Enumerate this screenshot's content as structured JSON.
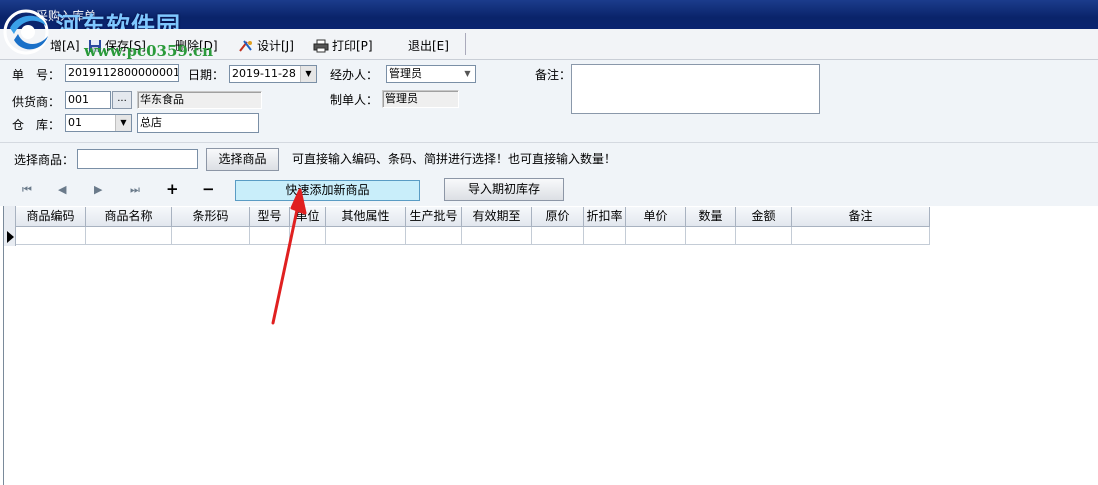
{
  "window": {
    "title": "采购入库单"
  },
  "watermark": {
    "site_name": "河东软件园",
    "url": "www.pc0359.cn"
  },
  "toolbar": {
    "add_label": "增[A]",
    "save_label": "保存[S]",
    "delete_label": "删除[D]",
    "design_label": "设计[J]",
    "print_label": "打印[P]",
    "exit_label": "退出[E]"
  },
  "form": {
    "order_no_label": "单　号：",
    "order_no_value": "2019112800000001",
    "date_label": "日期：",
    "date_value": "2019-11-28",
    "handler_label": "经办人：",
    "handler_value": "管理员",
    "remark_label": "备注：",
    "supplier_label": "供货商：",
    "supplier_code": "001",
    "supplier_browse": "...",
    "supplier_name": "华东食品",
    "creator_label": "制单人：",
    "creator_value": "管理员",
    "warehouse_label": "仓　库：",
    "warehouse_code": "01",
    "warehouse_name": "总店"
  },
  "select": {
    "label": "选择商品：",
    "input_value": "",
    "button_label": "选择商品",
    "hint": "可直接输入编码、条码、简拼进行选择！也可直接输入数量！",
    "quick_add_label": "快速添加新商品",
    "import_label": "导入期初库存"
  },
  "navigator": {
    "first": "⏮",
    "prev": "◀",
    "next": "▶",
    "last": "⏭",
    "add": "+",
    "remove": "−"
  },
  "grid": {
    "columns": [
      "商品编码",
      "商品名称",
      "条形码",
      "型号",
      "单位",
      "其他属性",
      "生产批号",
      "有效期至",
      "原价",
      "折扣率",
      "单价",
      "数量",
      "金额",
      "备注"
    ]
  },
  "colors": {
    "titlebar": "#0a246a",
    "highlight_button": "#c9eefa",
    "arrow": "#e02020"
  }
}
